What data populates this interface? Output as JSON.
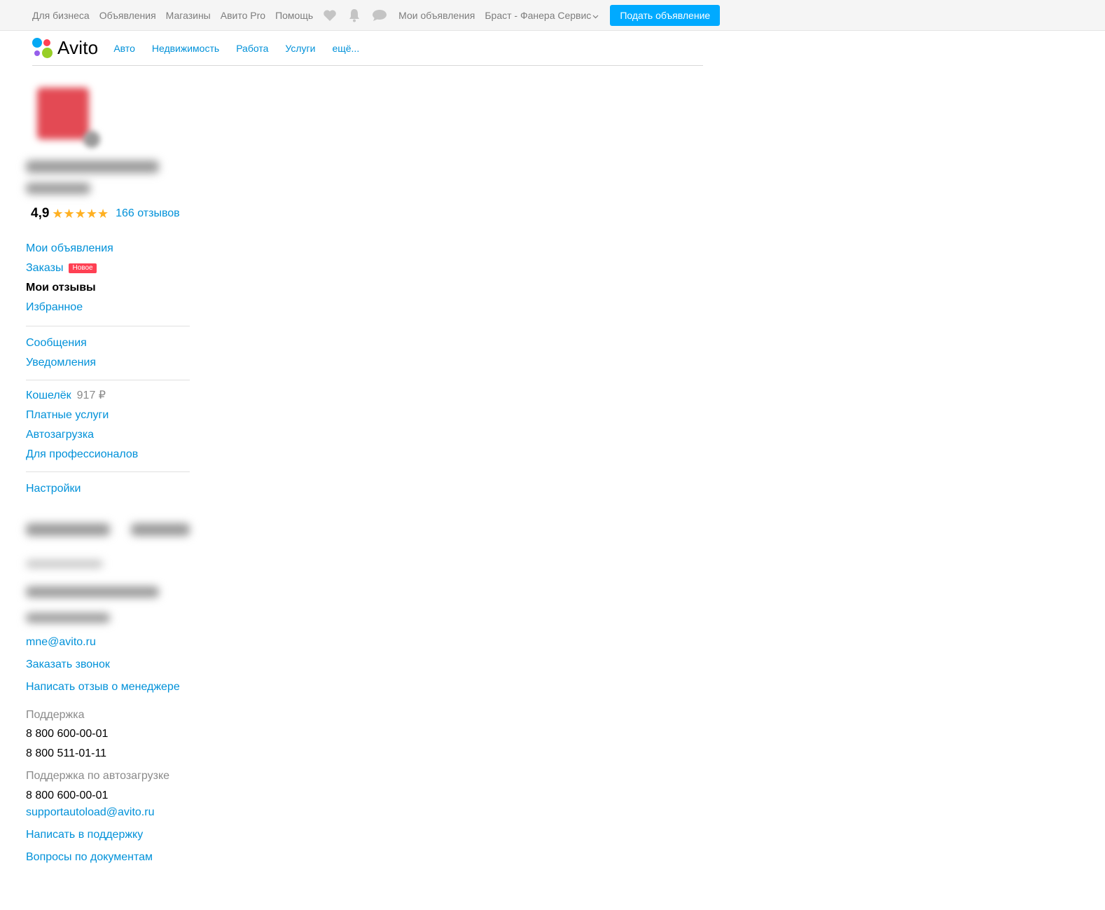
{
  "topbar": {
    "links": [
      "Для бизнеса",
      "Объявления",
      "Магазины",
      "Авито Pro",
      "Помощь"
    ],
    "icons": [
      "heart-icon",
      "bell-icon",
      "chat-icon"
    ],
    "my_ads": "Мои объявления",
    "user_name": "Браст - Фанера Сервис",
    "post_button": "Подать объявление"
  },
  "header": {
    "logo_text": "Avito",
    "categories": [
      "Авто",
      "Недвижимость",
      "Работа",
      "Услуги",
      "ещё..."
    ]
  },
  "profile": {
    "rating": "4,9",
    "stars": "★★★★★",
    "reviews_link": "166 отзывов"
  },
  "sidebar": {
    "group1": [
      "Мои объявления",
      "Заказы",
      "Мои отзывы",
      "Избранное"
    ],
    "orders_badge": "Новое",
    "group2": [
      "Сообщения",
      "Уведомления"
    ],
    "wallet_label": "Кошелёк",
    "wallet_amount": "917 ₽",
    "group3": [
      "Платные услуги",
      "Автозагрузка",
      "Для профессионалов"
    ],
    "settings": "Настройки"
  },
  "contacts": {
    "manager_email": "mne@avito.ru",
    "order_call": "Заказать звонок",
    "manager_review": "Написать отзыв о менеджере",
    "support_label": "Поддержка",
    "support_phone_1": "8 800 600-00-01",
    "support_phone_2": "8 800 511-01-11",
    "autoload_label": "Поддержка по автозагрузке",
    "autoload_phone": "8 800 600-00-01",
    "autoload_email": "supportautoload@avito.ru",
    "write_support": "Написать в поддержку",
    "documents": "Вопросы по документам"
  },
  "colors": {
    "link": "#0091d9",
    "button": "#00aaff",
    "badge": "#ff4053",
    "star": "#ffb021",
    "topbar_bg": "#f5f5f5"
  }
}
